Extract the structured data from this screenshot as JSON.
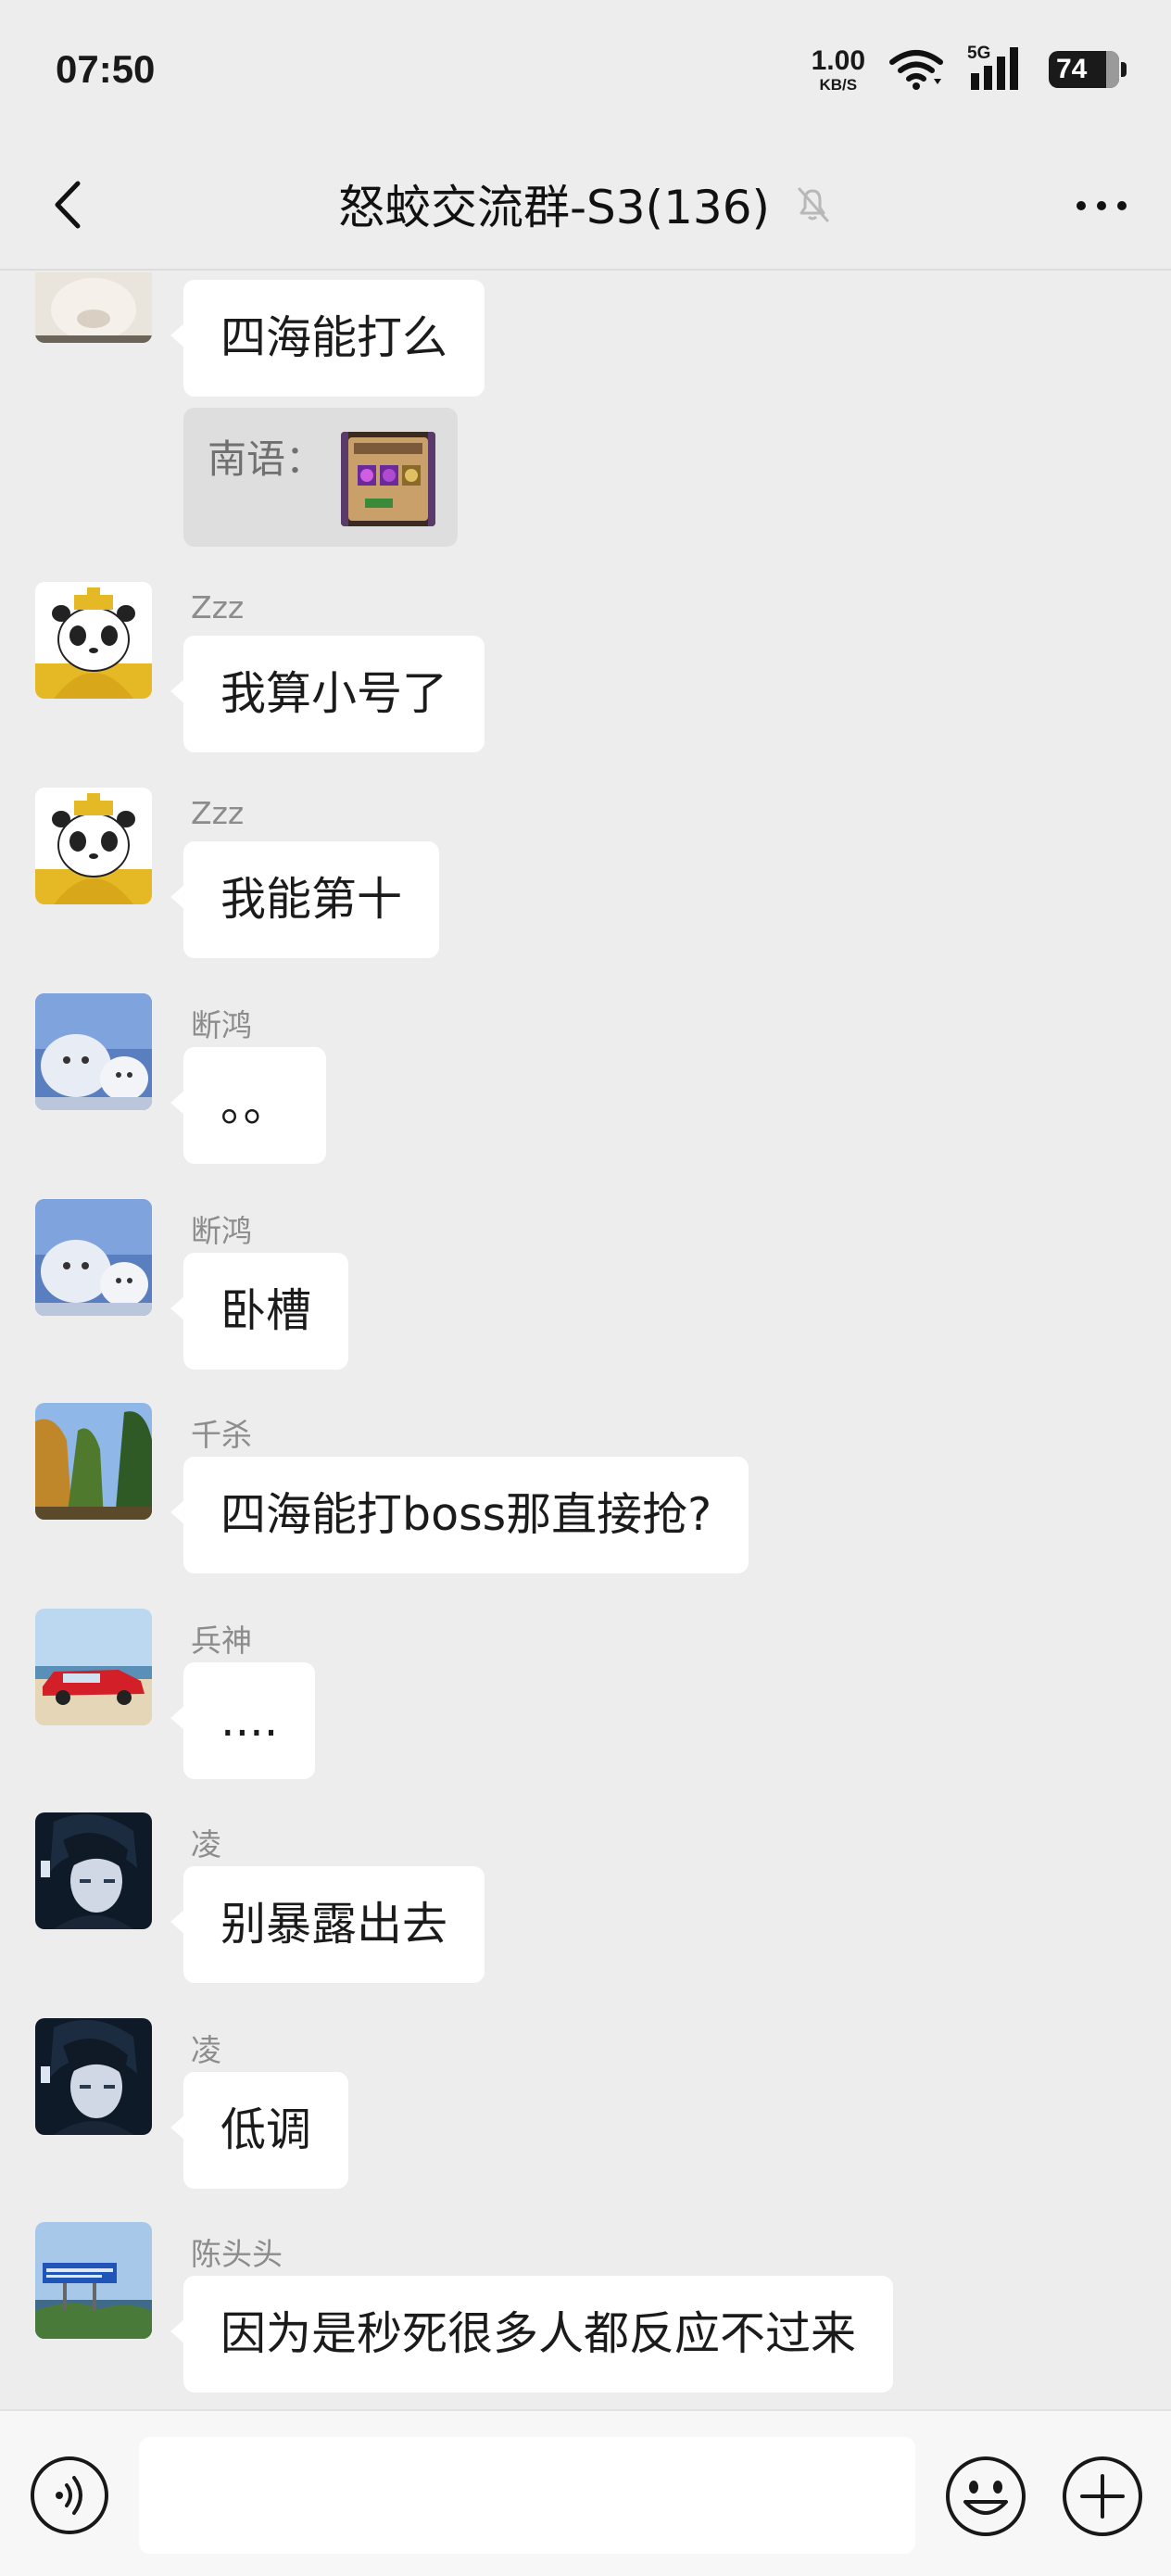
{
  "status_bar": {
    "time": "07:50",
    "net_speed_value": "1.00",
    "net_speed_unit": "KB/S",
    "network_label": "5G",
    "battery": "74"
  },
  "header": {
    "title": "怒蛟交流群-S3(136)",
    "back_icon": "chevron-left-icon",
    "mute_icon": "bell-off-icon",
    "more_icon": "ellipsis-icon"
  },
  "messages": [
    {
      "sender": "",
      "text": "四海能打么"
    },
    {
      "quote_label": "南语："
    },
    {
      "sender": "Zzz",
      "text": "我算小号了"
    },
    {
      "sender": "Zzz",
      "text": "我能第十"
    },
    {
      "sender": "断鸿",
      "text": "。。"
    },
    {
      "sender": "断鸿",
      "text": "卧槽"
    },
    {
      "sender": "千杀",
      "text": "四海能打boss那直接抢?"
    },
    {
      "sender": "兵神",
      "text": "...."
    },
    {
      "sender": "凌",
      "text": "别暴露出去"
    },
    {
      "sender": "凌",
      "text": "低调"
    },
    {
      "sender": "陈头头",
      "text": "因为是秒死很多人都反应不过来"
    }
  ],
  "input_bar": {
    "placeholder": "",
    "voice_icon": "voice-icon",
    "emoji_icon": "emoji-icon",
    "plus_icon": "plus-icon"
  },
  "colors": {
    "background": "#ededed",
    "bubble": "#ffffff",
    "sender_text": "#8c8c8c"
  }
}
